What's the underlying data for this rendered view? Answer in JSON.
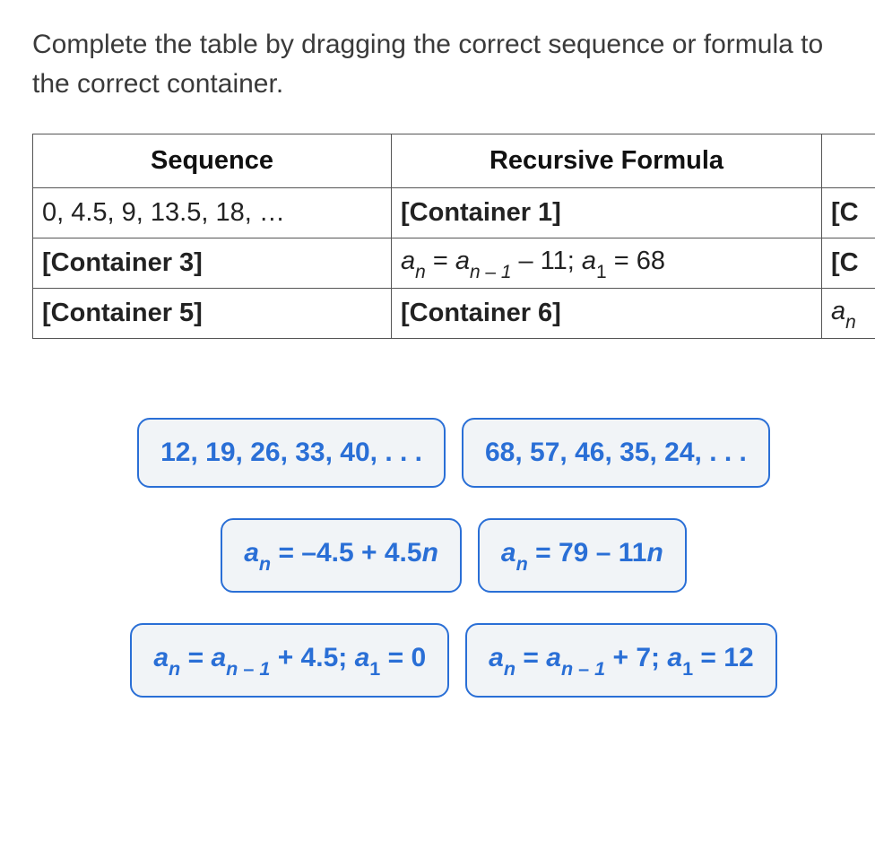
{
  "instructions": "Complete the table by dragging the correct sequence or formula to the correct container.",
  "table": {
    "headers": {
      "sequence": "Sequence",
      "recursive": "Recursive Formula",
      "extra": ""
    },
    "rows": [
      {
        "sequence": {
          "type": "text",
          "value": "0, 4.5, 9, 13.5, 18, …"
        },
        "recursive": {
          "type": "container",
          "label": "[Container 1]"
        },
        "extra": {
          "type": "clipped",
          "value": "[C"
        }
      },
      {
        "sequence": {
          "type": "container",
          "label": "[Container 3]"
        },
        "recursive": {
          "type": "formula",
          "value": "a_n = a_{n-1} - 11; a_1 = 68"
        },
        "extra": {
          "type": "clipped",
          "value": "[C"
        }
      },
      {
        "sequence": {
          "type": "container",
          "label": "[Container 5]"
        },
        "recursive": {
          "type": "container",
          "label": "[Container 6]"
        },
        "extra": {
          "type": "clipped_formula",
          "value": "a_n"
        }
      }
    ]
  },
  "tiles": {
    "row1": [
      {
        "type": "text",
        "value": "12, 19, 26, 33, 40, . . ."
      },
      {
        "type": "text",
        "value": "68, 57, 46, 35, 24, . . ."
      }
    ],
    "row2": [
      {
        "type": "formula",
        "value": "a_n = -4.5 + 4.5n"
      },
      {
        "type": "formula",
        "value": "a_n = 79 - 11n"
      }
    ],
    "row3": [
      {
        "type": "formula",
        "value": "a_n = a_{n-1} + 4.5; a_1 = 0"
      },
      {
        "type": "formula",
        "value": "a_n = a_{n-1} + 7; a_1 = 12"
      }
    ]
  },
  "colors": {
    "tile_border": "#2a6fd6",
    "tile_bg": "#f1f4f7"
  }
}
